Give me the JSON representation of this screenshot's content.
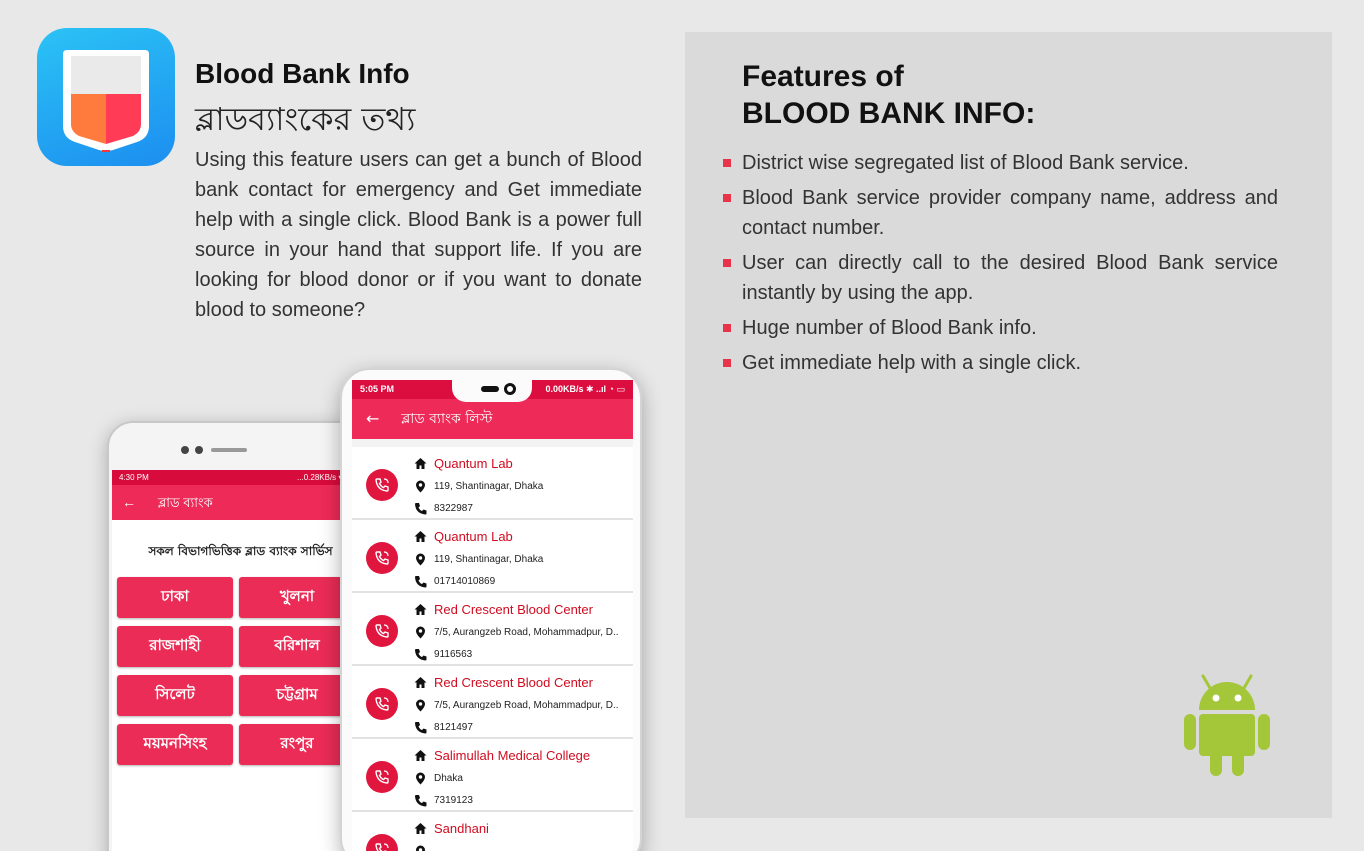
{
  "info": {
    "title": "Blood Bank Info",
    "subtitle": "ব্লাডব্যাংকের তথ্য",
    "description": "Using this feature users can get a bunch of Blood bank contact for emergency and Get immediate help with a single click. Blood Bank is a power full source in your hand that support life. If you are looking for blood donor or if you want to donate blood to someone?"
  },
  "features": {
    "title_line1": "Features of",
    "title_line2": "BLOOD BANK INFO:",
    "items": [
      "District wise segregated list of Blood Bank service.",
      "Blood Bank service provider company name, address and contact number.",
      "User can directly call to the desired Blood Bank service instantly by using the app.",
      "Huge number of Blood Bank info.",
      "Get immediate help with a single click."
    ]
  },
  "back_phone": {
    "status_time": "4:30 PM",
    "status_right": "...0.28KB/s ▾ ..ıl ⊙",
    "appbar_title": "ব্লাড ব্যাংক",
    "heading": "সকল বিভাগভিত্তিক ব্লাড ব্যাংক সার্ভিস",
    "divisions": [
      "ঢাকা",
      "খুলনা",
      "রাজশাহী",
      "বরিশাল",
      "সিলেট",
      "চট্টগ্রাম",
      "ময়মনসিংহ",
      "রংপুর"
    ]
  },
  "front_phone": {
    "status_time": "5:05 PM",
    "status_right": "0.00KB/s ✱ ..ıl ◔ ▭",
    "appbar_title": "ব্লাড ব্যাংক লিস্ট",
    "entries": [
      {
        "name": "Quantum Lab",
        "address": "119, Shantinagar, Dhaka",
        "phone": "8322987"
      },
      {
        "name": "Quantum Lab",
        "address": "119, Shantinagar, Dhaka",
        "phone": "01714010869"
      },
      {
        "name": "Red Crescent Blood Center",
        "address": "7/5, Aurangzeb Road, Mohammadpur, D..",
        "phone": "9116563"
      },
      {
        "name": "Red Crescent Blood Center",
        "address": "7/5, Aurangzeb Road, Mohammadpur, D..",
        "phone": "8121497"
      },
      {
        "name": "Salimullah Medical College",
        "address": "Dhaka",
        "phone": "7319123"
      },
      {
        "name": "Sandhani",
        "address": "",
        "phone": ""
      }
    ]
  },
  "colors": {
    "accent": "#ee2a58",
    "status_bar": "#dc0d3f",
    "name_text": "#d10b20",
    "bullet": "#e8334a",
    "android_green": "#a4c639"
  },
  "icons": [
    "blood-bag-icon",
    "android-logo-icon",
    "home-icon",
    "location-pin-icon",
    "phone-icon",
    "call-icon",
    "back-arrow-icon"
  ]
}
